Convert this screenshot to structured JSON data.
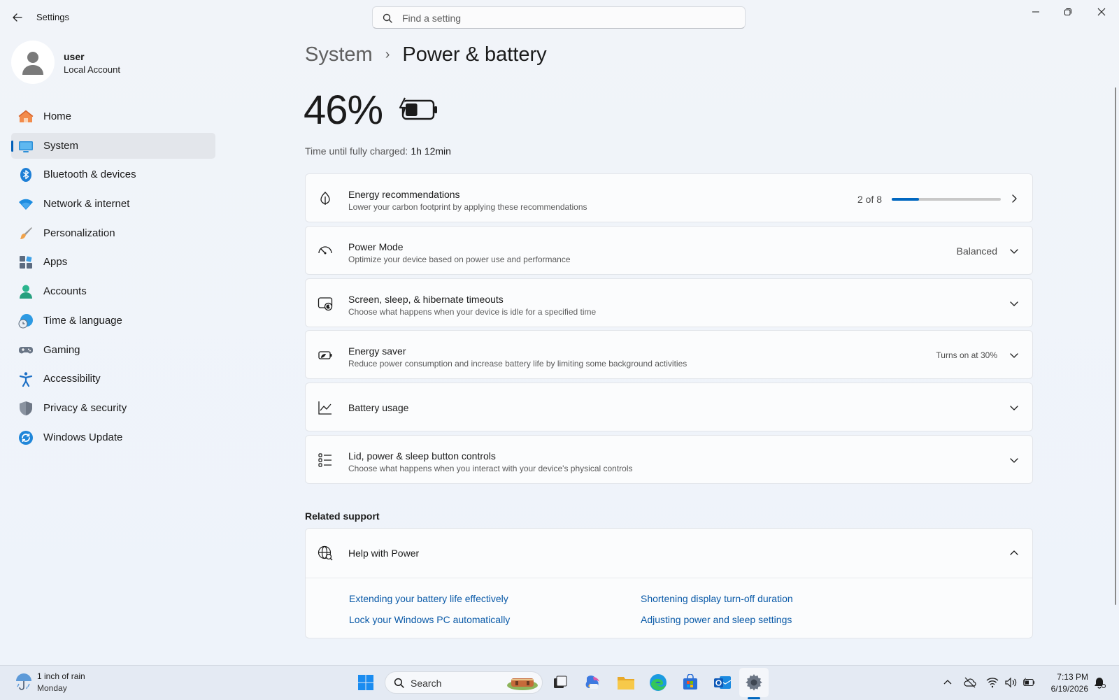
{
  "window": {
    "app_title": "Settings",
    "search_placeholder": "Find a setting"
  },
  "profile": {
    "name": "user",
    "account_type": "Local Account"
  },
  "sidebar": {
    "items": [
      {
        "label": "Home",
        "icon": "home-icon"
      },
      {
        "label": "System",
        "icon": "monitor-icon",
        "selected": true
      },
      {
        "label": "Bluetooth & devices",
        "icon": "bluetooth-icon"
      },
      {
        "label": "Network & internet",
        "icon": "wifi-icon"
      },
      {
        "label": "Personalization",
        "icon": "brush-icon"
      },
      {
        "label": "Apps",
        "icon": "apps-icon"
      },
      {
        "label": "Accounts",
        "icon": "person-icon"
      },
      {
        "label": "Time & language",
        "icon": "globe-clock-icon"
      },
      {
        "label": "Gaming",
        "icon": "gamepad-icon"
      },
      {
        "label": "Accessibility",
        "icon": "accessibility-icon"
      },
      {
        "label": "Privacy & security",
        "icon": "shield-icon"
      },
      {
        "label": "Windows Update",
        "icon": "update-icon"
      }
    ]
  },
  "breadcrumb": {
    "parent": "System",
    "separator": "›",
    "current": "Power & battery"
  },
  "battery": {
    "percent_label": "46%",
    "level": 0.46,
    "charge_label": "Time until fully charged:",
    "charge_value": "1h 12min"
  },
  "cards": {
    "energy_recommendations": {
      "title": "Energy recommendations",
      "description": "Lower your carbon footprint by applying these recommendations",
      "progress_text": "2 of 8",
      "progress_fraction": 0.25
    },
    "power_mode": {
      "title": "Power Mode",
      "description": "Optimize your device based on power use and performance",
      "value": "Balanced"
    },
    "screen_sleep": {
      "title": "Screen, sleep, & hibernate timeouts",
      "description": "Choose what happens when your device is idle for a specified time"
    },
    "energy_saver": {
      "title": "Energy saver",
      "description": "Reduce power consumption and increase battery life by limiting some background activities",
      "value": "Turns on at 30%"
    },
    "battery_usage": {
      "title": "Battery usage"
    },
    "lid_power": {
      "title": "Lid, power & sleep button controls",
      "description": "Choose what happens when you interact with your device's physical controls"
    }
  },
  "related_support": {
    "section_title": "Related support",
    "help_title": "Help with Power",
    "links": [
      "Extending your battery life effectively",
      "Shortening display turn-off duration",
      "Lock your Windows PC automatically",
      "Adjusting power and sleep settings"
    ]
  },
  "taskbar": {
    "weather_text": "1 inch of rain",
    "weather_day": "Monday",
    "search_label": "Search",
    "time": "7:13 PM",
    "date": "6/19/2026"
  },
  "colors": {
    "accent": "#0067c0",
    "link": "#0a5aa8"
  }
}
